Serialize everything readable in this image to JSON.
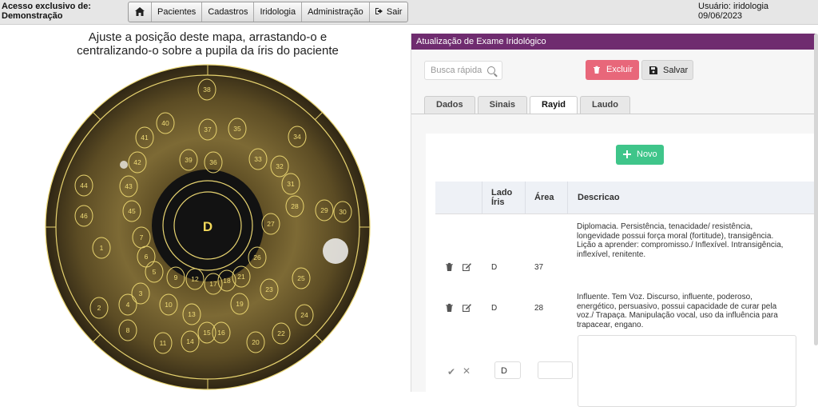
{
  "topbar": {
    "access_line1": "Acesso exclusivo de:",
    "access_line2": "Demonstração",
    "menu": [
      {
        "label": "",
        "icon": "home-icon"
      },
      {
        "label": "Pacientes"
      },
      {
        "label": "Cadastros"
      },
      {
        "label": "Iridologia"
      },
      {
        "label": "Administração"
      },
      {
        "label": "Sair",
        "icon": "exit-icon"
      }
    ],
    "user": "Usuário: iridologia",
    "date": "09/06/2023"
  },
  "map": {
    "instruction_line1": "Ajuste a posição deste mapa, arrastando-o e",
    "instruction_line2": "centralizando-o sobre a pupila da íris do paciente",
    "side": "D",
    "zones": [
      "1",
      "2",
      "3",
      "4",
      "5",
      "6",
      "7",
      "8",
      "9",
      "10",
      "11",
      "12",
      "13",
      "14",
      "15",
      "16",
      "17",
      "18",
      "19",
      "20",
      "21",
      "22",
      "23",
      "24",
      "25",
      "26",
      "27",
      "28",
      "29",
      "30",
      "31",
      "32",
      "33",
      "34",
      "35",
      "36",
      "37",
      "38",
      "39",
      "40",
      "41",
      "42",
      "43",
      "44",
      "45",
      "46"
    ]
  },
  "panel": {
    "title": "Atualização de Exame Iridológico",
    "search_placeholder": "Busca rápida",
    "delete_label": "Excluir",
    "save_label": "Salvar",
    "tabs": [
      "Dados",
      "Sinais",
      "Rayid",
      "Laudo"
    ],
    "active_tab": "Rayid",
    "new_label": "Novo",
    "columns": {
      "lado": "Lado Íris",
      "area": "Área",
      "descricao": "Descricao"
    },
    "rows": [
      {
        "lado": "D",
        "area": "37",
        "descricao": "Diplomacia. Persistência, tenacidade/ resistência, longevidade possui força moral (fortitude), transigência. Lição a aprender: compromisso./ Inflexível. Intransigência, inflexível, renitente."
      },
      {
        "lado": "D",
        "area": "28",
        "descricao": "Influente. Tem Voz. Discurso, influente, poderoso, energético, persuasivo, possui capacidade de curar pela voz./ Trapaça. Manipulação vocal, uso da influência para trapacear, engano."
      }
    ],
    "edit_row": {
      "lado": "D",
      "area": ""
    }
  },
  "colors": {
    "header": "#6f2c6f",
    "danger": "#e8677a",
    "success": "#3fc58a",
    "iris_line": "#e8d470"
  }
}
